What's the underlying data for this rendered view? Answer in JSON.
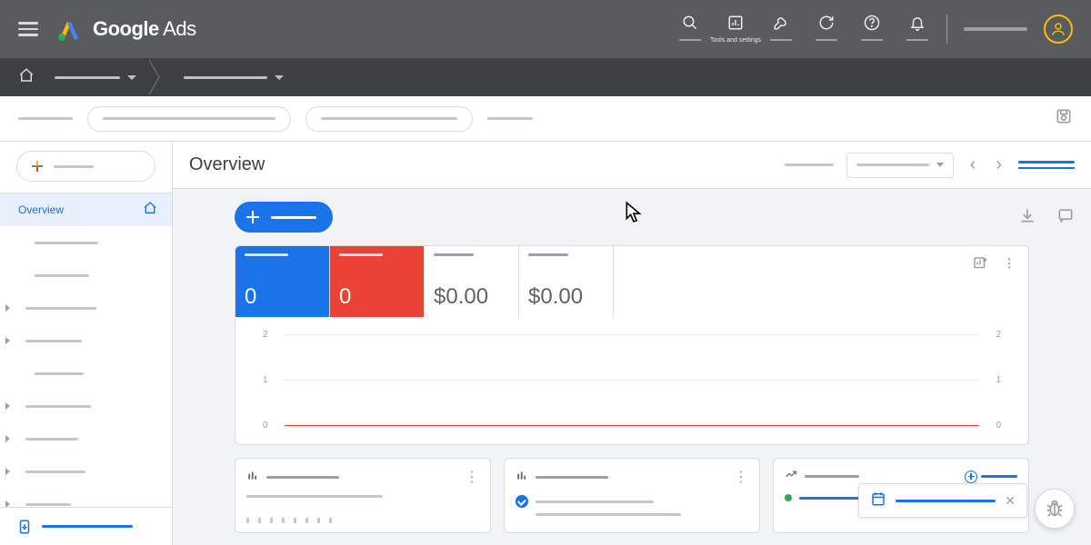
{
  "brand": {
    "name": "Google Ads"
  },
  "header": {
    "tools_label": "Tools and settings"
  },
  "sidebar": {
    "active_label": "Overview"
  },
  "content": {
    "title": "Overview",
    "metrics": [
      {
        "value": "0"
      },
      {
        "value": "0"
      },
      {
        "value": "$0.00"
      },
      {
        "value": "$0.00"
      }
    ]
  },
  "chart_data": {
    "type": "line",
    "ylim": [
      0,
      2
    ],
    "yticks": [
      0,
      1,
      2
    ],
    "series": [
      {
        "name": "metric-blue",
        "values": [
          0
        ],
        "color": "#1a73e8"
      },
      {
        "name": "metric-red",
        "values": [
          0
        ],
        "color": "#ea4335"
      }
    ],
    "title": "",
    "xlabel": "",
    "ylabel": ""
  }
}
